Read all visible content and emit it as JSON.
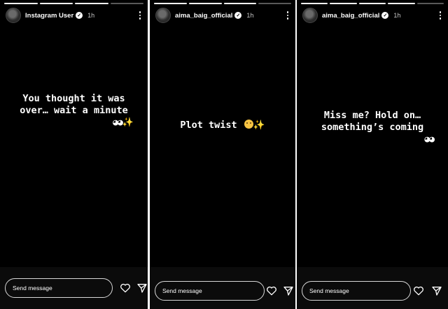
{
  "stories": [
    {
      "username": "Instagram User",
      "time": "1h",
      "caption_lines": [
        "You thought it was",
        "over… wait a minute"
      ],
      "emoji": {
        "eyes": "◕◕",
        "sparkle": "✨"
      },
      "send_placeholder": "Send message"
    },
    {
      "username": "aima_baig_official",
      "time": "1h",
      "caption_lines": [
        "Plot twist"
      ],
      "emoji": {
        "sparkle": "✨"
      },
      "send_placeholder": "Send message"
    },
    {
      "username": "aima_baig_official",
      "time": "1h",
      "caption_lines": [
        "Miss me? Hold on…",
        "something’s coming"
      ],
      "emoji": {
        "eyes": "◕◕"
      },
      "send_placeholder": "Send message"
    }
  ],
  "icons": {
    "verified": "verified-badge-icon",
    "more": "more-options-icon",
    "like": "heart-icon",
    "share": "send-icon"
  },
  "colors": {
    "background": "#000000",
    "text": "#ffffff",
    "progress_active": "#ffffff"
  }
}
